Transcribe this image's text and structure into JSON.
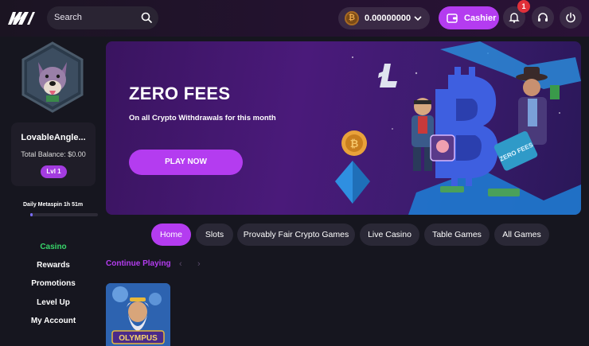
{
  "header": {
    "search_placeholder": "Search",
    "balance_amount": "0.00000000",
    "balance_coin_symbol": "₿",
    "cashier_label": "Cashier",
    "notification_count": "1"
  },
  "profile": {
    "username": "LovableAngle...",
    "total_balance": "Total Balance: $0.00",
    "level": "Lvl 1"
  },
  "metaspin": {
    "label": "Daily Metaspin 1h 51m",
    "progress": 0.03
  },
  "nav": {
    "items": [
      {
        "label": "Casino"
      },
      {
        "label": "Rewards"
      },
      {
        "label": "Promotions"
      },
      {
        "label": "Level Up"
      },
      {
        "label": "My Account"
      }
    ]
  },
  "banner": {
    "title": "ZERO FEES",
    "subtitle": "On all Crypto Withdrawals for this month",
    "cta": "PLAY NOW",
    "sign_text": "ZERO FEES"
  },
  "tabs": [
    {
      "label": "Home"
    },
    {
      "label": "Slots"
    },
    {
      "label": "Provably Fair Crypto Games"
    },
    {
      "label": "Live Casino"
    },
    {
      "label": "Table Games"
    },
    {
      "label": "All Games"
    }
  ],
  "section": {
    "title": "Continue Playing",
    "prev_arrow": "‹",
    "next_arrow": "›"
  },
  "game": {
    "logo_text": "OLYMPUS"
  },
  "colors": {
    "accent": "#b43cf0",
    "active_nav": "#38d56a",
    "notification": "#e0303a"
  }
}
